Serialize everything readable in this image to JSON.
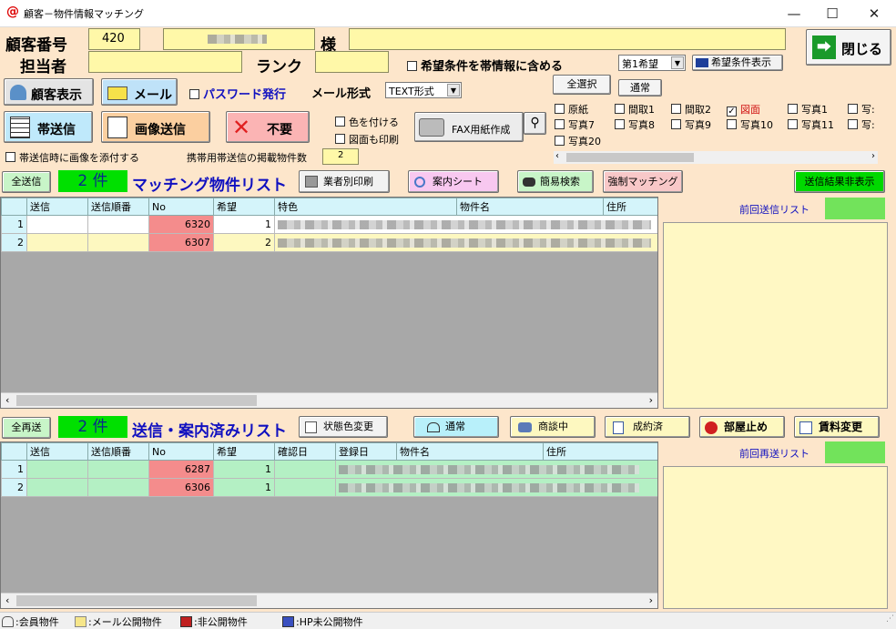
{
  "window": {
    "title": "顧客－物件情報マッチング",
    "min_glyph": "—",
    "max_glyph": "☐",
    "close_glyph": "✕"
  },
  "customer": {
    "number_label": "顧客番号",
    "number_value": "420",
    "sama_label": "様",
    "staff_label": "担当者",
    "rank_label": "ランク",
    "include_conditions_label": "希望条件を帯情報に含める",
    "wish_select": "第1希望",
    "show_conditions_button": "希望条件表示",
    "close_button": "閉じる"
  },
  "toolbar": {
    "customer_display": "顧客表示",
    "mail": "メール",
    "password_label": "パスワード発行",
    "mail_format_label": "メール形式",
    "mail_format_value": "TEXT形式",
    "select_all": "全選択",
    "normal": "通常",
    "obi_send": "帯送信",
    "image_send": "画像送信",
    "unneeded": "不要",
    "color_label": "色を付ける",
    "print_plan_label": "図面も印刷",
    "fax_button": "FAX用紙作成",
    "attach_image_label": "帯送信時に画像を添付する",
    "mobile_count_label": "携帯用帯送信の掲載物件数",
    "mobile_count_value": "2"
  },
  "image_options": [
    {
      "label": "原紙",
      "checked": false,
      "red": false
    },
    {
      "label": "間取1",
      "checked": false,
      "red": false
    },
    {
      "label": "間取2",
      "checked": false,
      "red": false
    },
    {
      "label": "図面",
      "checked": true,
      "red": true
    },
    {
      "label": "写真1",
      "checked": false,
      "red": false
    },
    {
      "label": "写:",
      "checked": false,
      "red": false
    },
    {
      "label": "写真7",
      "checked": false,
      "red": false
    },
    {
      "label": "写真8",
      "checked": false,
      "red": false
    },
    {
      "label": "写真9",
      "checked": false,
      "red": false
    },
    {
      "label": "写真10",
      "checked": false,
      "red": false
    },
    {
      "label": "写真11",
      "checked": false,
      "red": false
    },
    {
      "label": "写:",
      "checked": false,
      "red": false
    },
    {
      "label": "写真20",
      "checked": false,
      "red": false
    }
  ],
  "matching": {
    "send_all": "全送信",
    "count": "2 件",
    "title": "マッチング物件リスト",
    "print_by_vendor": "業者別印刷",
    "guide_sheet": "案内シート",
    "simple_search": "簡易検索",
    "force_matching": "強制マッチング",
    "hide_results": "送信結果非表示",
    "columns": [
      "送信",
      "送信順番",
      "No",
      "希望",
      "特色",
      "物件名",
      "住所"
    ],
    "rows": [
      {
        "idx": "1",
        "no": "6320",
        "wish": "1"
      },
      {
        "idx": "2",
        "no": "6307",
        "wish": "2"
      }
    ],
    "prev_list_label": "前回送信リスト"
  },
  "sent": {
    "resend_all": "全再送",
    "count": "2 件",
    "title": "送信・案内済みリスト",
    "status_color_change": "状態色変更",
    "normal": "通常",
    "negotiating": "商談中",
    "contracted": "成約済",
    "room_stop": "部屋止め",
    "rent_change": "賃料変更",
    "columns": [
      "送信",
      "送信順番",
      "No",
      "希望",
      "確認日",
      "登録日",
      "物件名",
      "住所"
    ],
    "rows": [
      {
        "idx": "1",
        "no": "6287",
        "wish": "1"
      },
      {
        "idx": "2",
        "no": "6306",
        "wish": "1"
      }
    ],
    "prev_list_label": "前回再送リスト"
  },
  "statusbar": {
    "member": ":会員物件",
    "mail_public": ":メール公開物件",
    "private": ":非公開物件",
    "hp_private": ":HP未公開物件"
  },
  "colors": {
    "background": "#fde6cb",
    "yellow_field": "#fff8a8",
    "green": "#00e000",
    "blue_text": "#1010c0",
    "no_cell": "#f48c8c",
    "row_green": "#b4f0c4",
    "row_yellow": "#fdf8c0"
  }
}
